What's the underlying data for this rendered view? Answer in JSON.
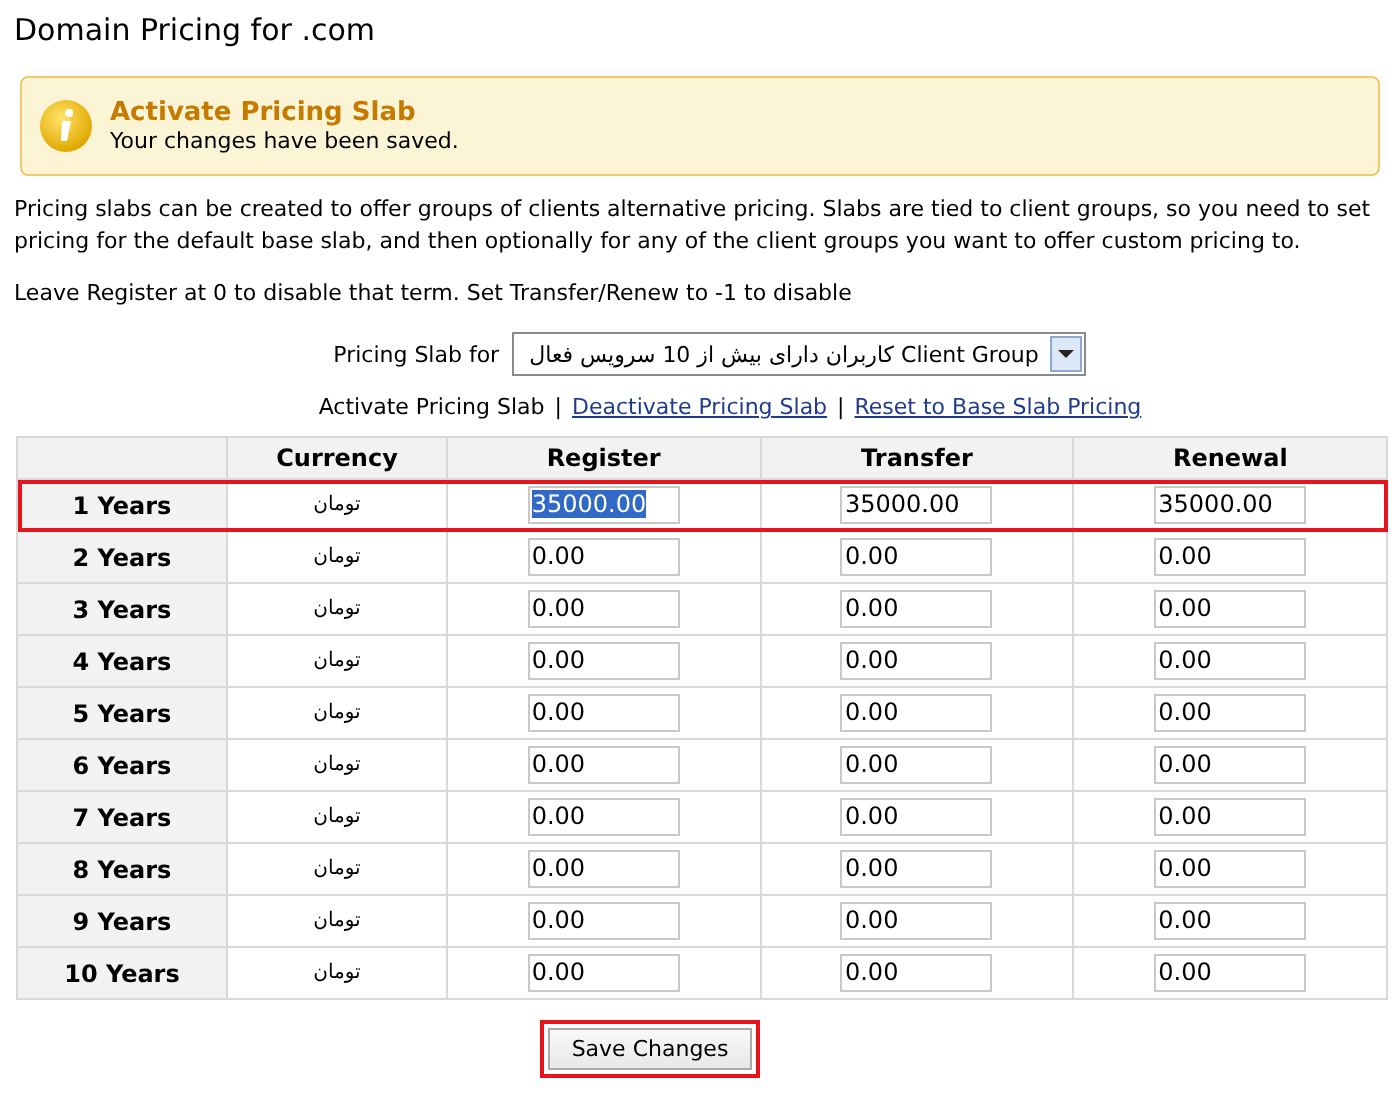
{
  "title": "Domain Pricing for .com",
  "notice": {
    "heading": "Activate Pricing Slab",
    "message": "Your changes have been saved."
  },
  "intro": "Pricing slabs can be created to offer groups of clients alternative pricing. Slabs are tied to client groups, so you need to set pricing for the default base slab, and then optionally for any of the client groups you want to offer custom pricing to.",
  "hint": "Leave Register at 0 to disable that term. Set Transfer/Renew to -1 to disable",
  "slab_select": {
    "label": "Pricing Slab for",
    "value": "کاربران دارای بیش از 10 سرویس فعال Client Group"
  },
  "action_separator": "|",
  "actions": [
    {
      "label": "Activate Pricing Slab",
      "kind": "text"
    },
    {
      "label": "Deactivate Pricing Slab",
      "kind": "link"
    },
    {
      "label": "Reset to Base Slab Pricing",
      "kind": "link"
    }
  ],
  "table": {
    "columns": [
      "Currency",
      "Register",
      "Transfer",
      "Renewal"
    ],
    "rows": [
      {
        "term": "1 Years",
        "currency": "تومان",
        "register": "35000.00",
        "transfer": "35000.00",
        "renewal": "35000.00",
        "highlighted": true,
        "register_selected": true
      },
      {
        "term": "2 Years",
        "currency": "تومان",
        "register": "0.00",
        "transfer": "0.00",
        "renewal": "0.00",
        "highlighted": false,
        "register_selected": false
      },
      {
        "term": "3 Years",
        "currency": "تومان",
        "register": "0.00",
        "transfer": "0.00",
        "renewal": "0.00",
        "highlighted": false,
        "register_selected": false
      },
      {
        "term": "4 Years",
        "currency": "تومان",
        "register": "0.00",
        "transfer": "0.00",
        "renewal": "0.00",
        "highlighted": false,
        "register_selected": false
      },
      {
        "term": "5 Years",
        "currency": "تومان",
        "register": "0.00",
        "transfer": "0.00",
        "renewal": "0.00",
        "highlighted": false,
        "register_selected": false
      },
      {
        "term": "6 Years",
        "currency": "تومان",
        "register": "0.00",
        "transfer": "0.00",
        "renewal": "0.00",
        "highlighted": false,
        "register_selected": false
      },
      {
        "term": "7 Years",
        "currency": "تومان",
        "register": "0.00",
        "transfer": "0.00",
        "renewal": "0.00",
        "highlighted": false,
        "register_selected": false
      },
      {
        "term": "8 Years",
        "currency": "تومان",
        "register": "0.00",
        "transfer": "0.00",
        "renewal": "0.00",
        "highlighted": false,
        "register_selected": false
      },
      {
        "term": "9 Years",
        "currency": "تومان",
        "register": "0.00",
        "transfer": "0.00",
        "renewal": "0.00",
        "highlighted": false,
        "register_selected": false
      },
      {
        "term": "10 Years",
        "currency": "تومان",
        "register": "0.00",
        "transfer": "0.00",
        "renewal": "0.00",
        "highlighted": false,
        "register_selected": false
      }
    ]
  },
  "save_button": {
    "label": "Save Changes",
    "highlighted": true
  }
}
